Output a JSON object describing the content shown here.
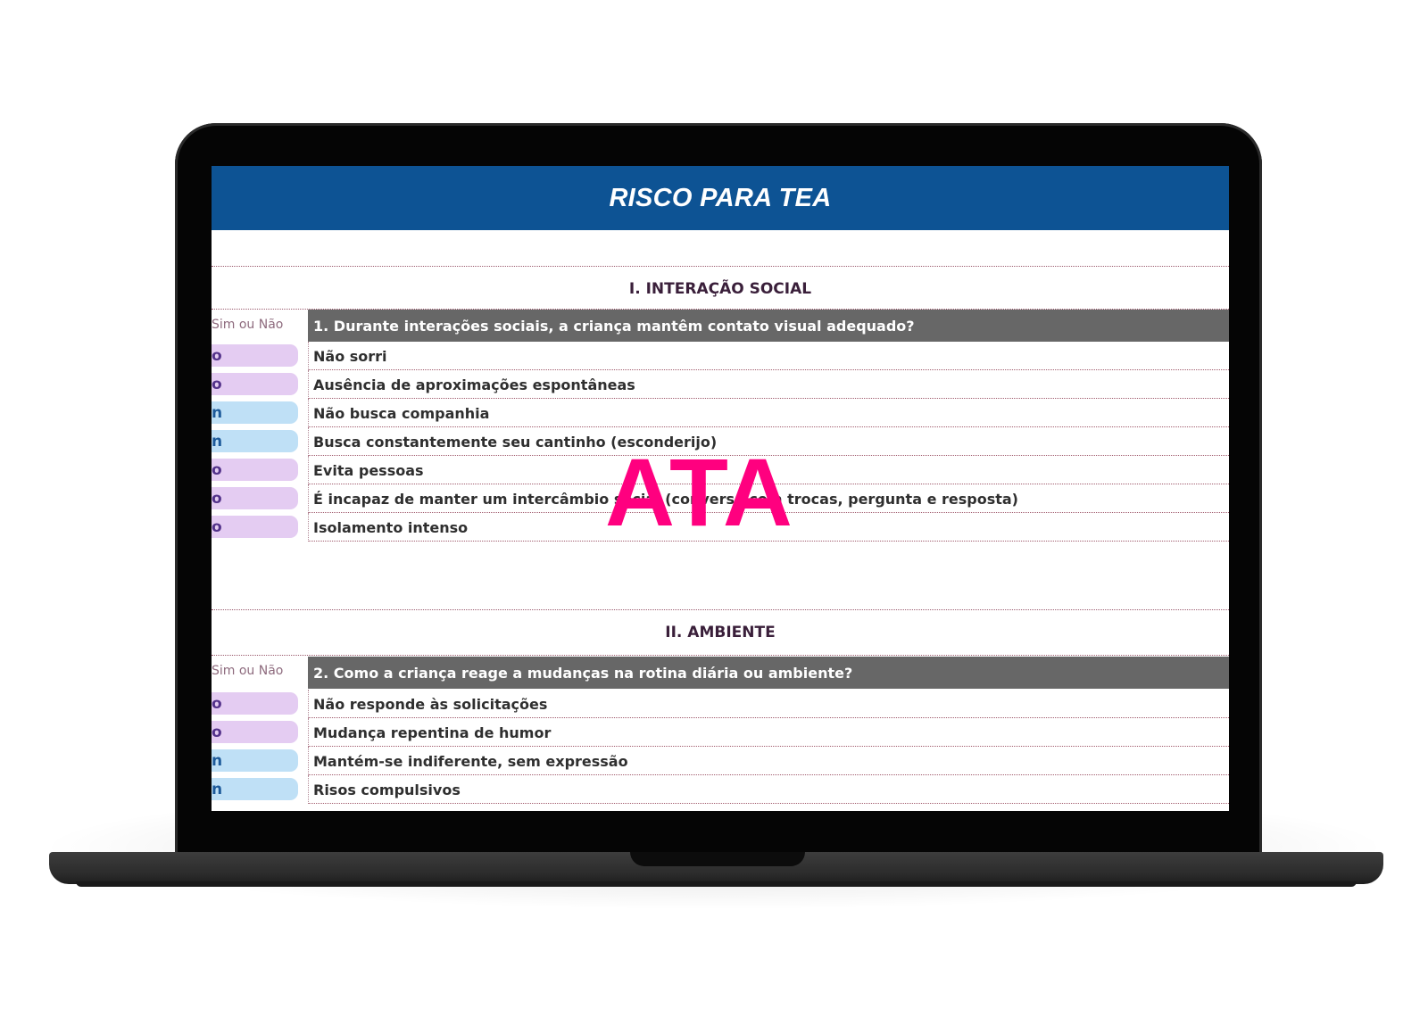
{
  "header": {
    "title": "RISCO PARA TEA"
  },
  "watermark": "ATA",
  "sections": [
    {
      "title": "I. INTERAÇÃO SOCIAL",
      "answer_label": "Sim ou Não",
      "question": "1. Durante interações sociais, a criança mantêm contato visual adequado?",
      "rows": [
        {
          "answer": "o",
          "text": "Não sorri"
        },
        {
          "answer": "o",
          "text": "Ausência de aproximações espontâneas"
        },
        {
          "answer": "n",
          "text": "Não busca companhia"
        },
        {
          "answer": "n",
          "text": "Busca constantemente seu cantinho (esconderijo)"
        },
        {
          "answer": "o",
          "text": "Evita pessoas"
        },
        {
          "answer": "o",
          "text": "É incapaz de manter um intercâmbio social (conversa com trocas, pergunta e resposta)"
        },
        {
          "answer": "o",
          "text": "Isolamento intenso"
        }
      ]
    },
    {
      "title": "II. AMBIENTE",
      "answer_label": "Sim ou Não",
      "question": "2. Como a criança reage a mudanças na rotina diária ou ambiente?",
      "rows": [
        {
          "answer": "o",
          "text": "Não responde às solicitações"
        },
        {
          "answer": "o",
          "text": "Mudança repentina de humor"
        },
        {
          "answer": "n",
          "text": "Mantém-se indiferente, sem expressão"
        },
        {
          "answer": "n",
          "text": "Risos compulsivos"
        }
      ]
    }
  ],
  "colors": {
    "header_bg": "#0d5394",
    "question_bg": "#676767",
    "pill_nao": "#e4ccf2",
    "pill_sim": "#bfe0f6",
    "watermark": "#ff007f"
  }
}
